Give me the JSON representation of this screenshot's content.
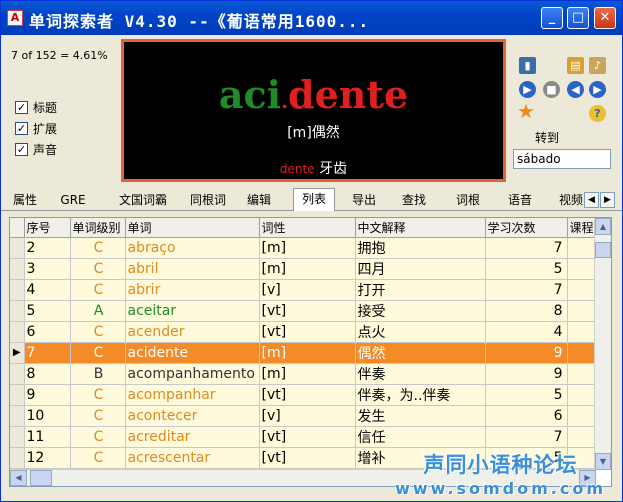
{
  "window": {
    "title": "单词探索者 V4.30 --《葡语常用1600...",
    "min_label": "_",
    "max_label": "□",
    "close_label": "✕"
  },
  "counter": "7 of 152 = 4.61%",
  "checkboxes": [
    {
      "label": "标题",
      "checked": true
    },
    {
      "label": "扩展",
      "checked": true
    },
    {
      "label": "声音",
      "checked": true
    }
  ],
  "display": {
    "word_part1": "aci",
    "dot": ".",
    "word_part2": "dente",
    "pos_meaning": "[m]偶然",
    "sample_word": "dente",
    "sample_meaning": "牙齿"
  },
  "goto": {
    "label": "转到",
    "value": "sábado"
  },
  "tabs": [
    "属性",
    "GRE",
    "文国词霸",
    "同根词",
    "编辑",
    "列表",
    "导出",
    "查找",
    "词根",
    "语音",
    "视频"
  ],
  "active_tab": "列表",
  "table": {
    "headers": [
      "序号",
      "单词级别",
      "单词",
      "词性",
      "中文解释",
      "学习次数",
      "课程"
    ],
    "rows": [
      {
        "no": "2",
        "level": "C",
        "word": "abraço",
        "pos": "[m]",
        "meaning": "拥抱",
        "count": "7"
      },
      {
        "no": "3",
        "level": "C",
        "word": "abril",
        "pos": "[m]",
        "meaning": "四月",
        "count": "5"
      },
      {
        "no": "4",
        "level": "C",
        "word": "abrir",
        "pos": "[v]",
        "meaning": "打开",
        "count": "7"
      },
      {
        "no": "5",
        "level": "A",
        "word": "aceitar",
        "pos": "[vt]",
        "meaning": "接受",
        "count": "8"
      },
      {
        "no": "6",
        "level": "C",
        "word": "acender",
        "pos": "[vt]",
        "meaning": "点火",
        "count": "4"
      },
      {
        "no": "7",
        "level": "C",
        "word": "acidente",
        "pos": "[m]",
        "meaning": "偶然",
        "count": "9",
        "selected": true
      },
      {
        "no": "8",
        "level": "B",
        "word": "acompanhamento",
        "pos": "[m]",
        "meaning": "伴奏",
        "count": "9"
      },
      {
        "no": "9",
        "level": "C",
        "word": "acompanhar",
        "pos": "[vt]",
        "meaning": "伴奏，为..伴奏",
        "count": "5"
      },
      {
        "no": "10",
        "level": "C",
        "word": "acontecer",
        "pos": "[v]",
        "meaning": "发生",
        "count": "6"
      },
      {
        "no": "11",
        "level": "C",
        "word": "acreditar",
        "pos": "[vt]",
        "meaning": "信任",
        "count": "7"
      },
      {
        "no": "12",
        "level": "C",
        "word": "acrescentar",
        "pos": "[vt]",
        "meaning": "增补",
        "count": "5"
      }
    ]
  },
  "watermark": {
    "line1": "声同小语种论坛",
    "line2": "www.somdom.com"
  },
  "colors": {
    "title_bar": "#0045c8",
    "display_border": "#e2623a",
    "selected_row": "#f58a28",
    "level_c": "#e08a20",
    "level_a": "#1e8c28"
  }
}
